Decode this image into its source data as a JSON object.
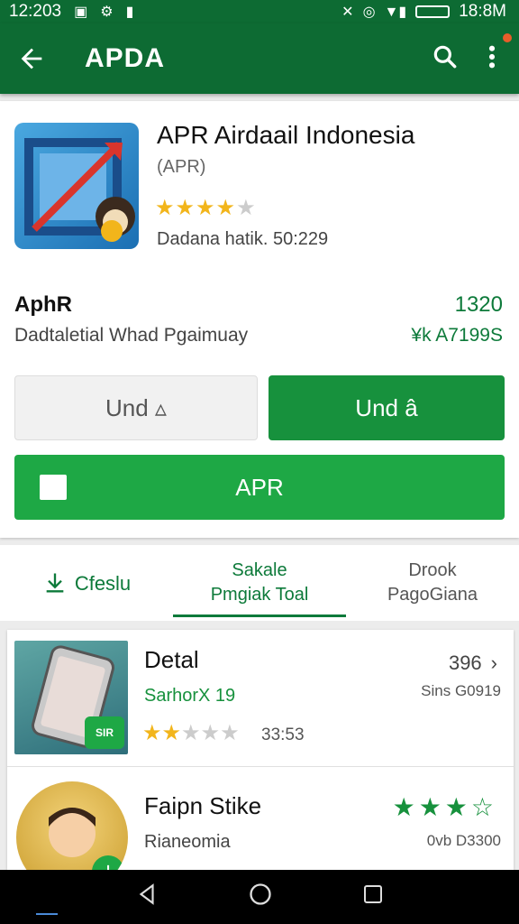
{
  "status_bar": {
    "time": "12:203",
    "right_time": "18:8M"
  },
  "app_bar": {
    "title": "APDA"
  },
  "app": {
    "name": "APR Airdaail Indonesia",
    "developer": "(APR)",
    "rating": 4.5,
    "meta": "Dadana hatik. 50:229",
    "section_title": "AphR",
    "section_number": "1320",
    "section_subtitle": "Dadtaletial Whad Pgaimuay",
    "section_price": "¥k A7199S"
  },
  "buttons": {
    "secondary_label": "Und ▵",
    "primary_label": "Und â",
    "install_label": "APR"
  },
  "tabs": [
    {
      "label": "Cfeslu",
      "active": false
    },
    {
      "label": "Sakale",
      "label2": "Pmgiak Toal",
      "active": true
    },
    {
      "label": "Drook",
      "label2": "PagoGiana",
      "active": false
    }
  ],
  "list": [
    {
      "title": "Detal",
      "subtitle": "SarhorX 19",
      "subtitle_color": "#17913d",
      "right_value": "396",
      "right_sub": "Sins G0919",
      "stars": 2,
      "meta": "33:53",
      "badge": "SIR"
    },
    {
      "title": "Faipn Stike",
      "subtitle": "Rianeomia",
      "right_sub": "0vb D3300",
      "green_stars": 3
    }
  ],
  "colors": {
    "brand_dark": "#0d6b33",
    "brand": "#17913d",
    "button_green": "#1ea845",
    "star": "#f2b51b"
  },
  "icons": [
    "back-arrow-icon",
    "search-icon",
    "overflow-menu-icon",
    "download-icon",
    "chevron-right-icon",
    "star-icon",
    "back-nav-icon",
    "home-nav-icon",
    "recents-nav-icon"
  ]
}
